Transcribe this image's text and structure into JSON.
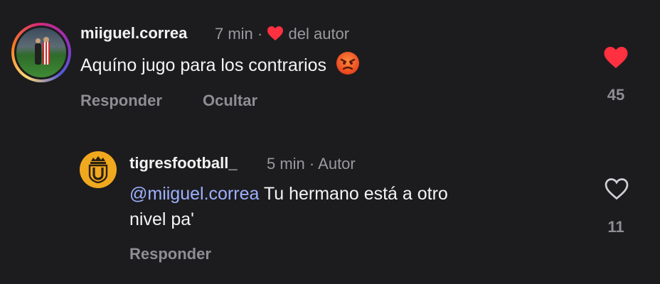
{
  "comments": [
    {
      "username": "miiguel.correa",
      "time": "7 min",
      "separator": "·",
      "badge_text": "del autor",
      "text": "Aquíno jugo para los contrarios",
      "emoji": "😡",
      "actions": {
        "reply": "Responder",
        "hide": "Ocultar"
      },
      "like_count": "45",
      "liked": true,
      "icons": {
        "badge": "heart-filled-icon",
        "like": "heart-filled-icon",
        "emoji": "angry-face-icon"
      }
    },
    {
      "username": "tigresfootball_",
      "time": "5 min",
      "separator": "·",
      "badge_text": "Autor",
      "mention": "@miiguel.correa",
      "text_line1": "Tu hermano está a otro",
      "text_line2": "nivel pa'",
      "actions": {
        "reply": "Responder"
      },
      "like_count": "11",
      "liked": false,
      "icons": {
        "like": "heart-outline-icon"
      }
    }
  ],
  "colors": {
    "background": "#1c1c1e",
    "liked": "#ff3040",
    "mention": "#9eb0ff",
    "secondary_text": "#8e8e93",
    "crest": "#f0a81f"
  }
}
